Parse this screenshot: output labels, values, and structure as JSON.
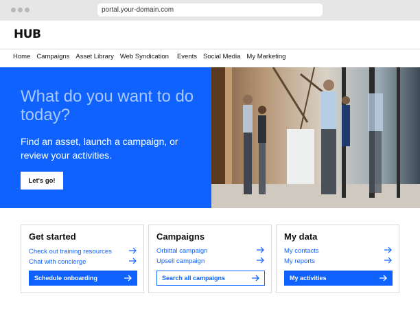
{
  "browser": {
    "url": "portal.your-domain.com"
  },
  "header": {
    "logo": "HUB"
  },
  "nav": [
    "Home",
    "Campaigns",
    "Asset Library",
    "Web Syndication",
    "Events",
    "Social Media",
    "My Marketing"
  ],
  "hero": {
    "headline": "What do you want to do today?",
    "subtext": "Find an asset, launch a campaign, or review your activities.",
    "cta_label": "Let's go!"
  },
  "cards": [
    {
      "title": "Get started",
      "links": [
        "Check out training resources",
        "Chat with concierge"
      ],
      "button": "Schedule onboarding"
    },
    {
      "title": "Campaigns",
      "links": [
        "Orbittal campaign",
        "Upsell campaign"
      ],
      "button": "Search all campaigns"
    },
    {
      "title": "My data",
      "links": [
        "My contacts",
        "My reports"
      ],
      "button": "My activities"
    }
  ],
  "colors": {
    "brand_blue": "#0f62fe",
    "headline_light": "#a6c8ff"
  },
  "icons": [
    "arrow-right-icon"
  ]
}
